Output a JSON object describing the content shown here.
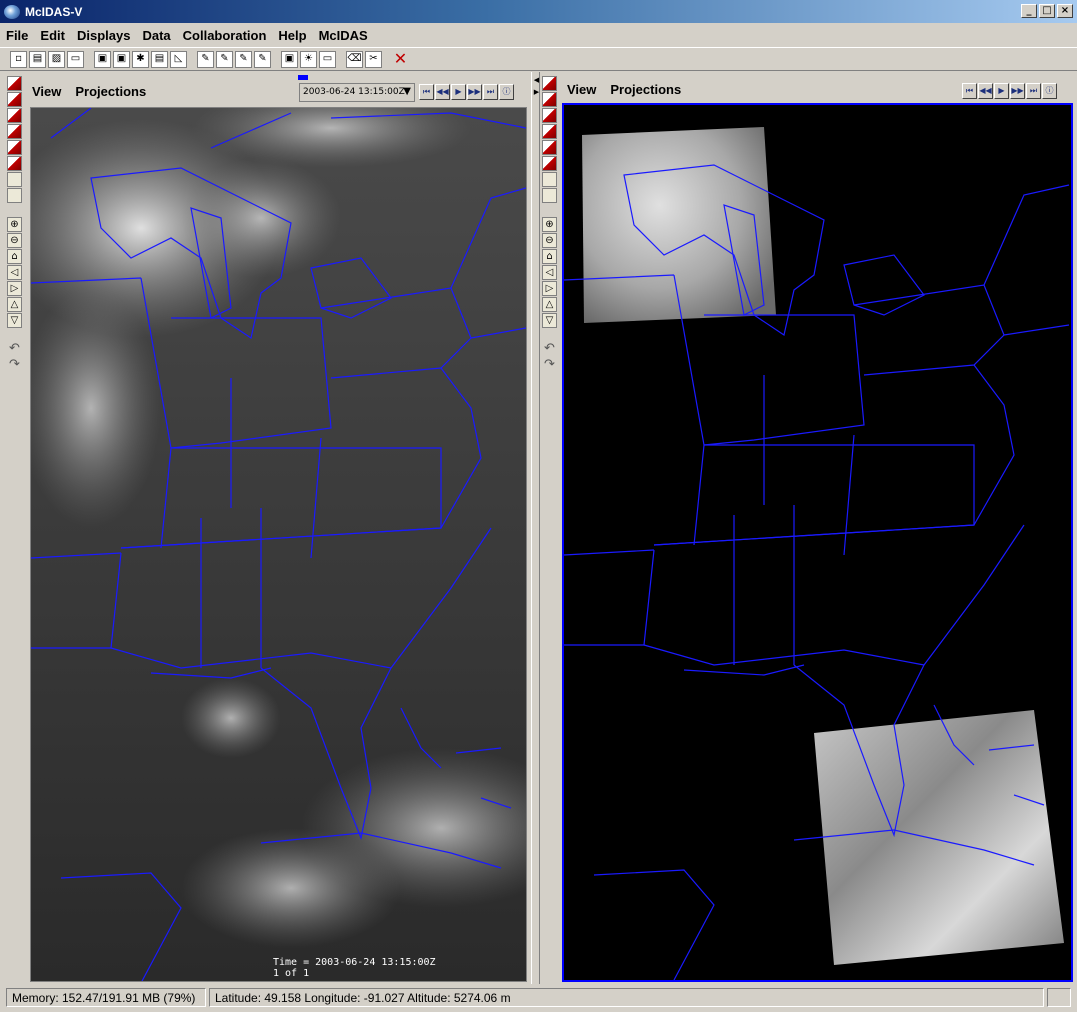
{
  "window": {
    "title": "McIDAS-V",
    "minimize": "_",
    "maximize": "□",
    "close": "×"
  },
  "menu": [
    "File",
    "Edit",
    "Displays",
    "Data",
    "Collaboration",
    "Help",
    "McIDAS"
  ],
  "toolbar": {
    "icons": [
      "new-doc-icon",
      "paste-icon",
      "new-window-icon",
      "open-folder-icon",
      "save-icon",
      "save-as-icon",
      "chooser-icon",
      "print-icon",
      "capture-icon",
      "edit-icon",
      "edit-formula-icon",
      "edit-settings-icon",
      "edit-color-icon",
      "jython-icon",
      "bulb-icon",
      "layout-icon",
      "eraser-icon",
      "scissors-icon",
      "delete-icon"
    ],
    "glyphs": [
      "▫",
      "▤",
      "▨",
      "▭",
      "▣",
      "▣",
      "✱",
      "▤",
      "◺",
      "✎",
      "✎",
      "✎",
      "✎",
      "▣",
      "☀",
      "▭",
      "⌫",
      "✂",
      "✕"
    ]
  },
  "left_panel": {
    "menu": [
      "View",
      "Projections"
    ],
    "time_select": "2003-06-24 13:15:00Z",
    "time_label_line1": "Time = 2003-06-24 13:15:00Z",
    "time_label_line2": "1 of 1"
  },
  "right_panel": {
    "menu": [
      "View",
      "Projections"
    ]
  },
  "anim_glyphs": [
    "⏮",
    "◀◀",
    "▶",
    "▶▶",
    "⏭",
    "ⓘ"
  ],
  "anim_names": [
    "first-frame-button",
    "step-back-button",
    "play-button",
    "step-forward-button",
    "last-frame-button",
    "animation-info-button"
  ],
  "vtool_glyphs": [
    "⌂",
    "↻",
    "↺",
    "⊕",
    "⊖",
    "⌂",
    "◁",
    "▷",
    "△",
    "▽",
    "↶",
    "↷"
  ],
  "status": {
    "memory": "Memory: 152.47/191.91 MB (79%)",
    "location": "Latitude: 49.158 Longitude: -91.027 Altitude: 5274.06 m"
  },
  "colors": {
    "map_lines": "#1a1aff",
    "accent": "#0a246a"
  }
}
